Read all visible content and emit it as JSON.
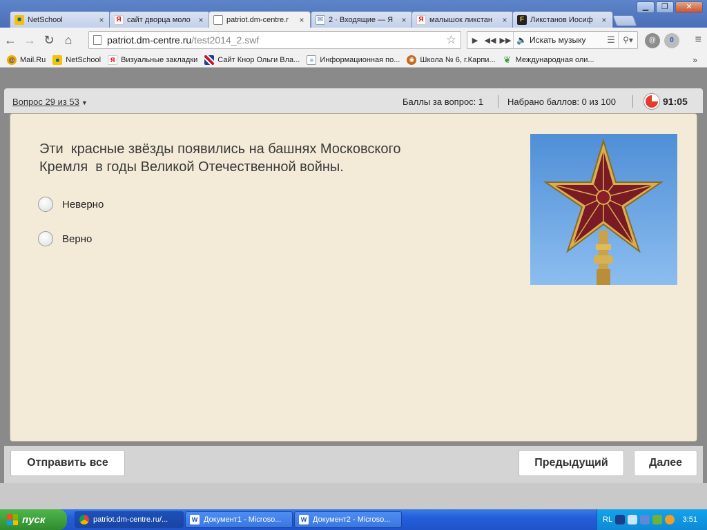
{
  "browser": {
    "tabs": [
      {
        "label": "NetSchool",
        "icon": "netschool-icon",
        "active": false
      },
      {
        "label": "сайт дворца моло",
        "icon": "yandex-icon",
        "active": false
      },
      {
        "label": "patriot.dm-centre.r",
        "icon": "page-icon",
        "active": true
      },
      {
        "label": "2 · Входящие — Я",
        "icon": "mail-icon",
        "active": false
      },
      {
        "label": "малышок ликстан",
        "icon": "yandex-icon",
        "active": false
      },
      {
        "label": "Ликстанов Иосиф",
        "icon": "fr-icon",
        "active": false
      }
    ],
    "url": {
      "host": "patriot.dm-centre.ru",
      "path": "/test2014_2.swf"
    },
    "music_search": "Искать музыку",
    "ext_badge": "0"
  },
  "bookmarks": [
    {
      "label": "Mail.Ru",
      "icon": "mailru-icon"
    },
    {
      "label": "NetSchool",
      "icon": "netschool-icon"
    },
    {
      "label": "Визуальные закладки",
      "icon": "yandex-icon"
    },
    {
      "label": "Сайт Кнор Ольги Вла...",
      "icon": "uk-flag-icon"
    },
    {
      "label": "Информационная по...",
      "icon": "document-icon"
    },
    {
      "label": "Школа № 6, г.Карпи...",
      "icon": "school-icon"
    },
    {
      "label": "Международная оли...",
      "icon": "leaf-icon"
    }
  ],
  "bookmarks_more": "»",
  "test": {
    "question_selector": "Вопрос 29 из 53",
    "points_per_question": "Баллы за вопрос: 1",
    "points_total": "Набрано баллов: 0 из 100",
    "timer": "91:05",
    "question": "Эти  красные звёзды появились на башнях Московского\nКремля  в годы Великой Отечественной войны.",
    "answers": [
      {
        "label": "Неверно"
      },
      {
        "label": "Верно"
      }
    ],
    "submit_all": "Отправить все",
    "previous": "Предыдущий",
    "next": "Далее"
  },
  "taskbar": {
    "start": "пуск",
    "tasks": [
      {
        "label": "patriot.dm-centre.ru/...",
        "icon": "chrome-icon"
      },
      {
        "label": "Документ1 - Microso...",
        "icon": "word-icon"
      },
      {
        "label": "Документ2 - Microso...",
        "icon": "word-icon"
      }
    ],
    "lang": "RL",
    "clock": "3:51"
  },
  "colors": {
    "chrome_frame": "#4a6fb9",
    "panel_bg": "#f3ead7",
    "timer_red": "#e63a2a",
    "taskbar_blue": "#245edb",
    "start_green": "#3a9a38"
  }
}
